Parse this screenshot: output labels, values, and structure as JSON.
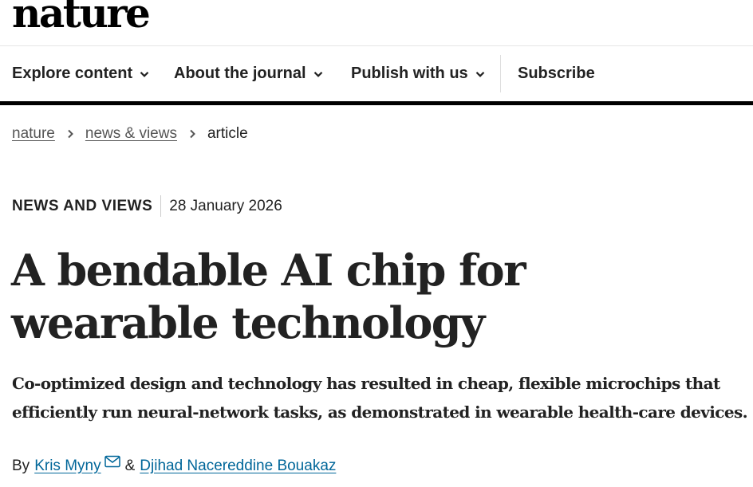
{
  "brand": {
    "logo": "nature"
  },
  "nav": {
    "items": [
      {
        "label": "Explore content",
        "icon": "chevron-down-icon"
      },
      {
        "label": "About the journal",
        "icon": "chevron-down-icon"
      },
      {
        "label": "Publish with us",
        "icon": "chevron-down-icon"
      }
    ],
    "subscribe": "Subscribe"
  },
  "breadcrumb": {
    "items": [
      "nature",
      "news & views",
      "article"
    ],
    "separator_icon": "chevron-right-icon"
  },
  "article": {
    "type": "NEWS AND VIEWS",
    "date": "28 January 2026",
    "title": "A bendable AI chip for wearable technology",
    "standfirst": "Co-optimized design and technology has resulted in cheap, flexible microchips that efficiently run neural-network tasks, as demonstrated in wearable health-care devices.",
    "byline": {
      "prefix": "By",
      "authors": [
        "Kris Myny",
        "Djihad Nacereddine Bouakaz"
      ],
      "conjunction": "&",
      "contact_icon": "mail-icon"
    }
  },
  "colors": {
    "text": "#222222",
    "link": "#006699",
    "nav_border": "#000000"
  }
}
